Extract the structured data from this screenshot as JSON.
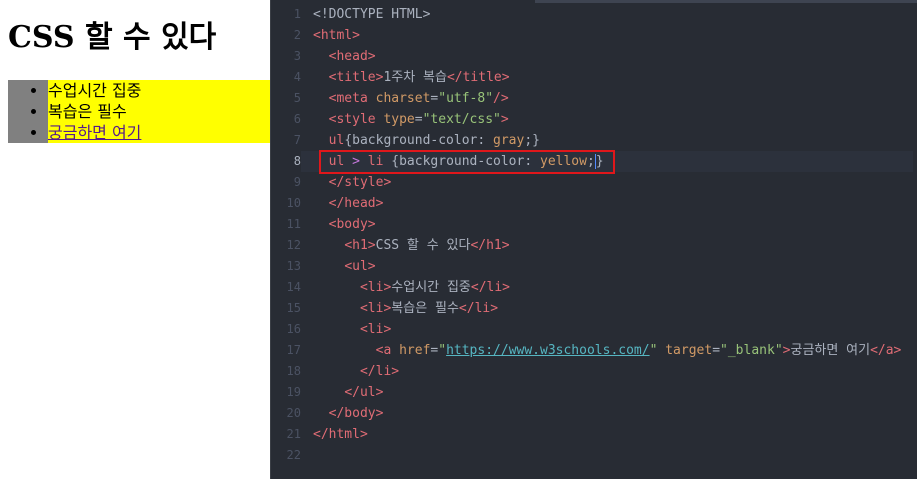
{
  "preview": {
    "heading": "CSS 할 수 있다",
    "items": [
      {
        "text": "수업시간 집중"
      },
      {
        "text": "복습은 필수"
      },
      {
        "text": "궁금하면 여기"
      }
    ]
  },
  "editor": {
    "line_numbers": [
      "1",
      "2",
      "3",
      "4",
      "5",
      "6",
      "7",
      "8",
      "9",
      "10",
      "11",
      "12",
      "13",
      "14",
      "15",
      "16",
      "17",
      "18",
      "19",
      "20",
      "21",
      "22"
    ],
    "active_line": "8",
    "code": {
      "l1": {
        "t": "<!DOCTYPE HTML>"
      },
      "l2": {
        "open": "<html>"
      },
      "l3": {
        "open": "<head>"
      },
      "l4": {
        "open": "<title>",
        "text": "1주차 복습",
        "close": "</title>"
      },
      "l5": {
        "open": "<meta ",
        "attr": "charset",
        "eq": "=",
        "val": "\"utf-8\"",
        "close": "/>"
      },
      "l6": {
        "open": "<style ",
        "attr": "type",
        "eq": "=",
        "val": "\"text/css\"",
        "close": ">"
      },
      "l7": {
        "sel": "ul",
        "brace_open": "{",
        "prop": "background-color",
        "colon": ": ",
        "value": "gray",
        "end": ";}"
      },
      "l8": {
        "sel1": "ul",
        "op": " > ",
        "sel2": "li",
        "space": " ",
        "brace_open": "{",
        "prop": "background-color",
        "colon": ": ",
        "value": "yellow",
        "semi": ";",
        "brace_close": "}"
      },
      "l9": {
        "close": "</style>"
      },
      "l10": {
        "close": "</head>"
      },
      "l11": {
        "open": "<body>"
      },
      "l12": {
        "open": "<h1>",
        "text": "CSS 할 수 있다",
        "close": "</h1>"
      },
      "l13": {
        "open": "<ul>"
      },
      "l14": {
        "open": "<li>",
        "text": "수업시간 집중",
        "close": "</li>"
      },
      "l15": {
        "open": "<li>",
        "text": "복습은 필수",
        "close": "</li>"
      },
      "l16": {
        "open": "<li>"
      },
      "l17": {
        "open": "<a ",
        "attr1": "href",
        "eq1": "=",
        "q1": "\"",
        "url": "https://www.w3schools.com/",
        "q2": "\"",
        "sp": " ",
        "attr2": "target",
        "eq2": "=",
        "val2": "\"_blank\"",
        "gt": ">",
        "text": "궁금하면 여기",
        "close": "</a>"
      },
      "l18": {
        "close": "</li>"
      },
      "l19": {
        "close": "</ul>"
      },
      "l20": {
        "close": "</body>"
      },
      "l21": {
        "close": "</html>"
      }
    },
    "highlight_color": "#e0171b"
  }
}
